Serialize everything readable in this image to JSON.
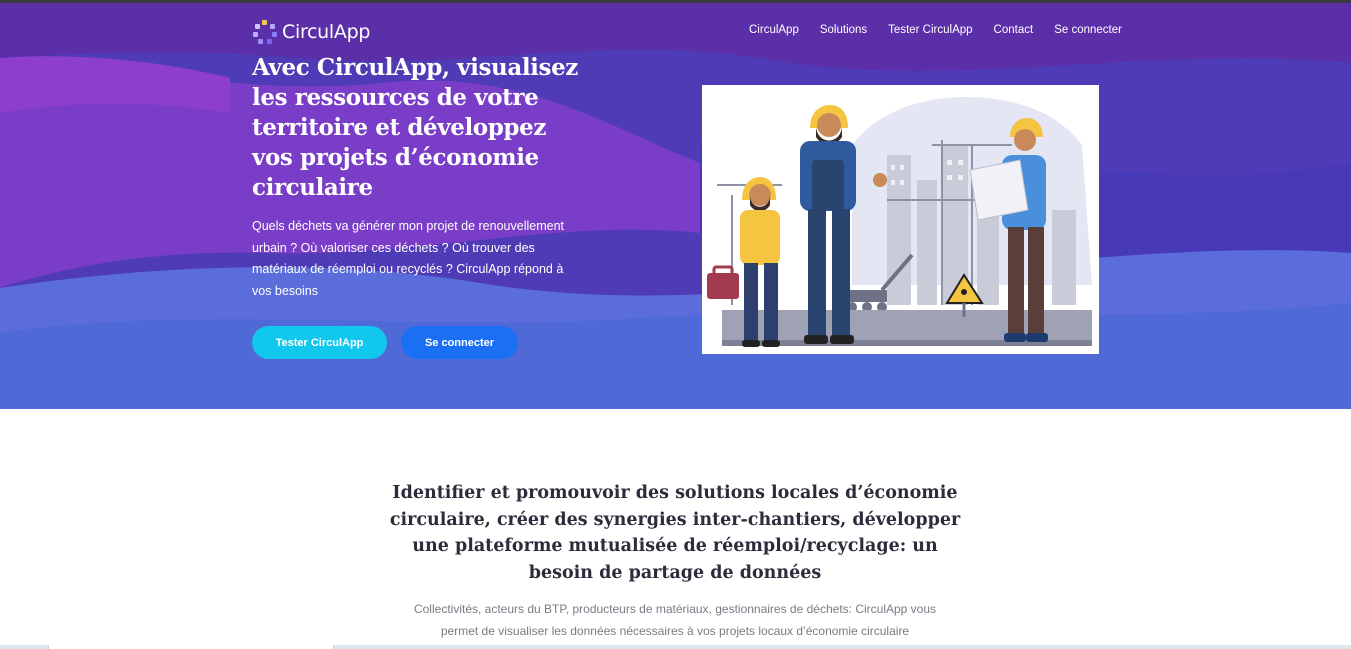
{
  "brand": {
    "name": "CirculApp"
  },
  "nav": {
    "items": [
      {
        "label": "CirculApp"
      },
      {
        "label": "Solutions"
      },
      {
        "label": "Tester CirculApp"
      },
      {
        "label": "Contact"
      },
      {
        "label": "Se connecter"
      }
    ]
  },
  "hero": {
    "title": "Avec CirculApp, visualisez les ressources de votre territoire et développez vos projets d’économie circulaire",
    "subtitle": "Quels déchets va générer mon projet de renouvellement urbain ? Où valoriser ces déchets ? Où trouver des matériaux de réemploi ou recyclés ? CirculApp répond à vos besoins",
    "cta_primary": "Tester CirculApp",
    "cta_secondary": "Se connecter"
  },
  "section": {
    "title": "Identifier et promouvoir des solutions locales d’économie circulaire, créer des synergies inter-chantiers, développer une plateforme mutualisée de réemploi/recyclage: un besoin de partage de données",
    "text": "Collectivités, acteurs du BTP, producteurs de matériaux, gestionnaires de déchets: CirculApp vous permet de visualiser les données nécessaires à vos projets locaux d’économie circulaire"
  },
  "colors": {
    "hero_base": "#4d38b3",
    "accent_cyan": "#11c7ee",
    "accent_blue": "#1a6ff2",
    "text_dark": "#2c2c3a",
    "text_muted": "#7a7a86"
  },
  "icons": {
    "logo": "circulapp-logo-icon"
  }
}
